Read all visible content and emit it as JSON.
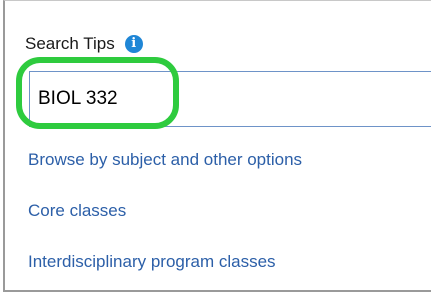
{
  "search": {
    "label": "Search Tips",
    "info_icon": "info-icon",
    "value": "BIOL 332"
  },
  "links": [
    {
      "label": "Browse by subject and other options"
    },
    {
      "label": "Core classes"
    },
    {
      "label": "Interdisciplinary program classes"
    }
  ],
  "colors": {
    "link": "#2c5fa8",
    "info_icon": "#1f86d6",
    "highlight_ring": "#2ecb3e",
    "input_border": "#6e93c8"
  }
}
